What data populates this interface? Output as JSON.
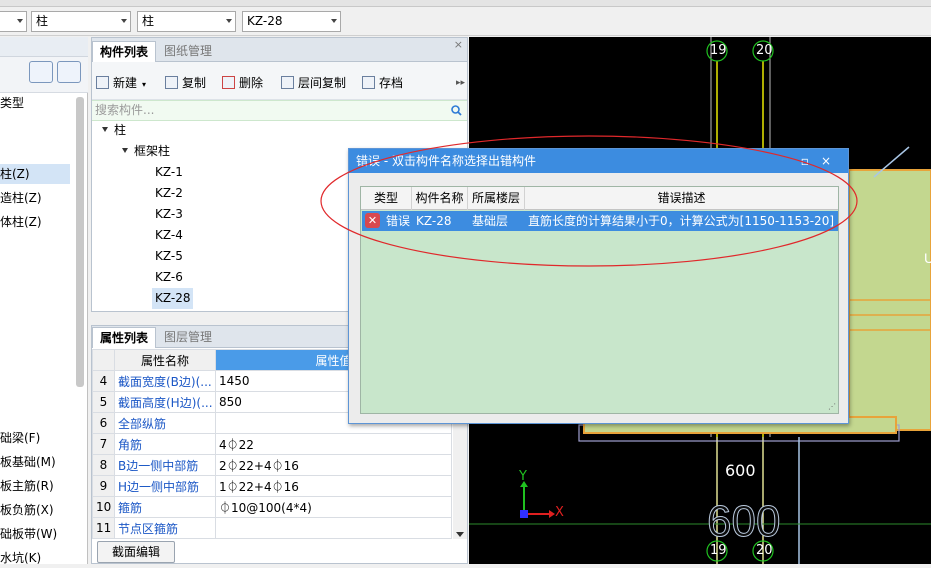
{
  "toolbar": {
    "combo1": "",
    "combo2": "柱",
    "combo3": "柱",
    "combo4": "KZ-28"
  },
  "left_panel": {
    "items": [
      "类型",
      "柱(Z)",
      "构造柱(Z)",
      "砌体柱(Z)",
      "基础梁(F)",
      "筏板基础(M)",
      "筏板主筋(R)",
      "筏板负筋(X)",
      "基础板带(W)",
      "集水坑(K)"
    ],
    "display_items": [
      "类型",
      "柱(Z)",
      "造柱(Z)",
      "体柱(Z)",
      "础梁(F)",
      "板基础(M)",
      "板主筋(R)",
      "板负筋(X)",
      "础板带(W)",
      "水坑(K)"
    ]
  },
  "component_panel": {
    "tabs": [
      "构件列表",
      "图纸管理"
    ],
    "close": "×",
    "buttons": [
      "新建",
      "复制",
      "删除",
      "层间复制",
      "存档"
    ],
    "search_placeholder": "搜索构件...",
    "tree": {
      "root": "柱",
      "group": "框架柱",
      "items": [
        "KZ-1",
        "KZ-2",
        "KZ-3",
        "KZ-4",
        "KZ-5",
        "KZ-6",
        "KZ-28"
      ],
      "selected": "KZ-28"
    }
  },
  "property_panel": {
    "tabs": [
      "属性列表",
      "图层管理"
    ],
    "header_name": "属性名称",
    "header_value": "属性值",
    "rows": [
      {
        "num": "4",
        "name": "截面宽度(B边)(...",
        "value": "1450"
      },
      {
        "num": "5",
        "name": "截面高度(H边)(...",
        "value": "850"
      },
      {
        "num": "6",
        "name": "全部纵筋",
        "value": ""
      },
      {
        "num": "7",
        "name": "角筋",
        "value": "4⏀22"
      },
      {
        "num": "8",
        "name": "B边一侧中部筋",
        "value": "2⏀22+4⏀16"
      },
      {
        "num": "9",
        "name": "H边一侧中部筋",
        "value": "1⏀22+4⏀16"
      },
      {
        "num": "10",
        "name": "箍筋",
        "value": "⏀10@100(4*4)"
      },
      {
        "num": "11",
        "name": "节点区箍筋",
        "value": ""
      }
    ],
    "edit_button": "截面编辑"
  },
  "cad": {
    "axis_labels": [
      "19",
      "20",
      "19",
      "20"
    ],
    "dim_small": "600",
    "dim_large": "600",
    "y_label": "Y",
    "x_label": "X"
  },
  "dialog": {
    "title": "错误 - 双击构件名称选择出错构件",
    "columns": [
      "类型",
      "构件名称",
      "所属楼层",
      "错误描述"
    ],
    "rows": [
      {
        "type": "错误",
        "name": "KZ-28",
        "floor": "基础层",
        "desc": "直筋长度的计算结果小于0，计算公式为[1150-1153-20]"
      }
    ]
  },
  "colors": {
    "dialog_title": "#3c8ce0",
    "grid_bg": "#c8e6cb",
    "selected_row": "#3d8ce0",
    "annotation": "#e0282b"
  }
}
